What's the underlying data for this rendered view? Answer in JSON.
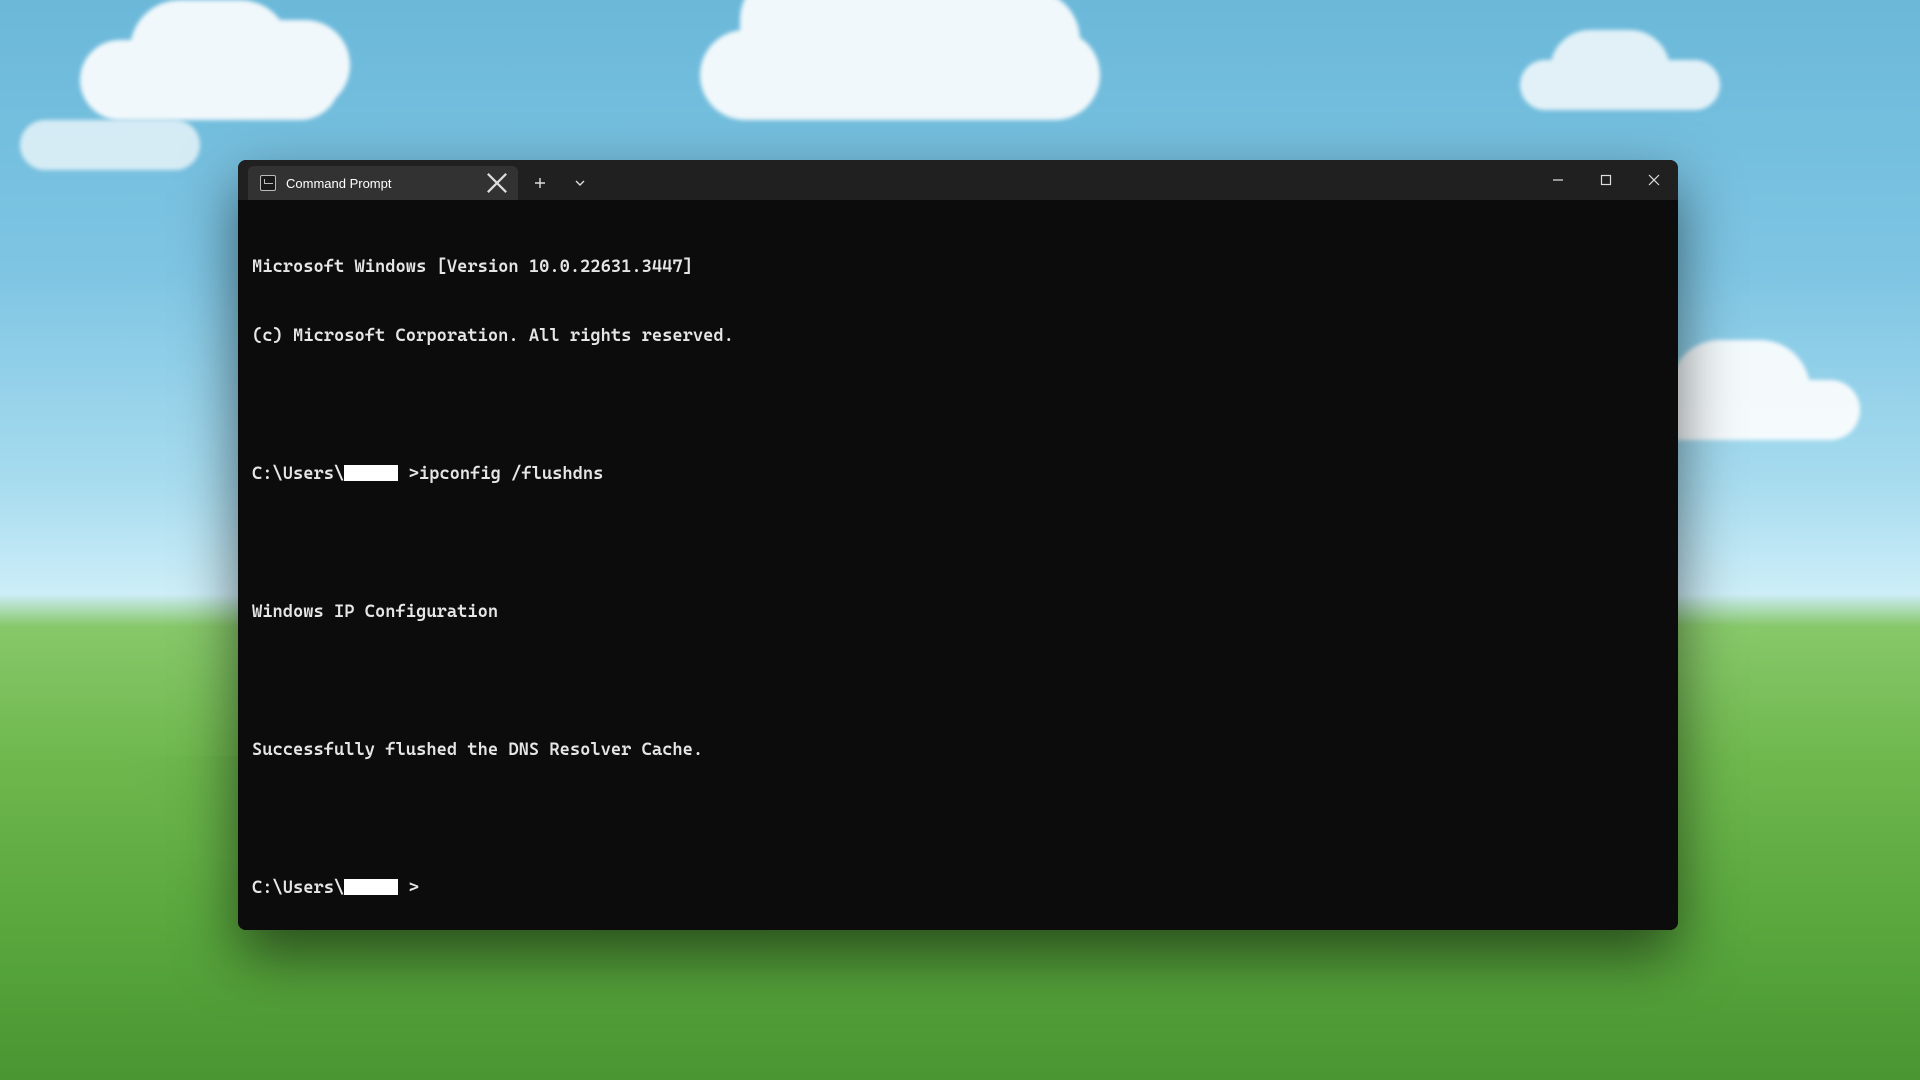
{
  "window": {
    "tab_title": "Command Prompt"
  },
  "terminal": {
    "header_line1": "Microsoft Windows [Version 10.0.22631.3447]",
    "header_line2": "(c) Microsoft Corporation. All rights reserved.",
    "prompt_prefix": "C:\\Users\\",
    "prompt_suffix": ">",
    "command": "ipconfig /flushdns",
    "section_title": "Windows IP Configuration",
    "result_msg": "Successfully flushed the DNS Resolver Cache."
  }
}
